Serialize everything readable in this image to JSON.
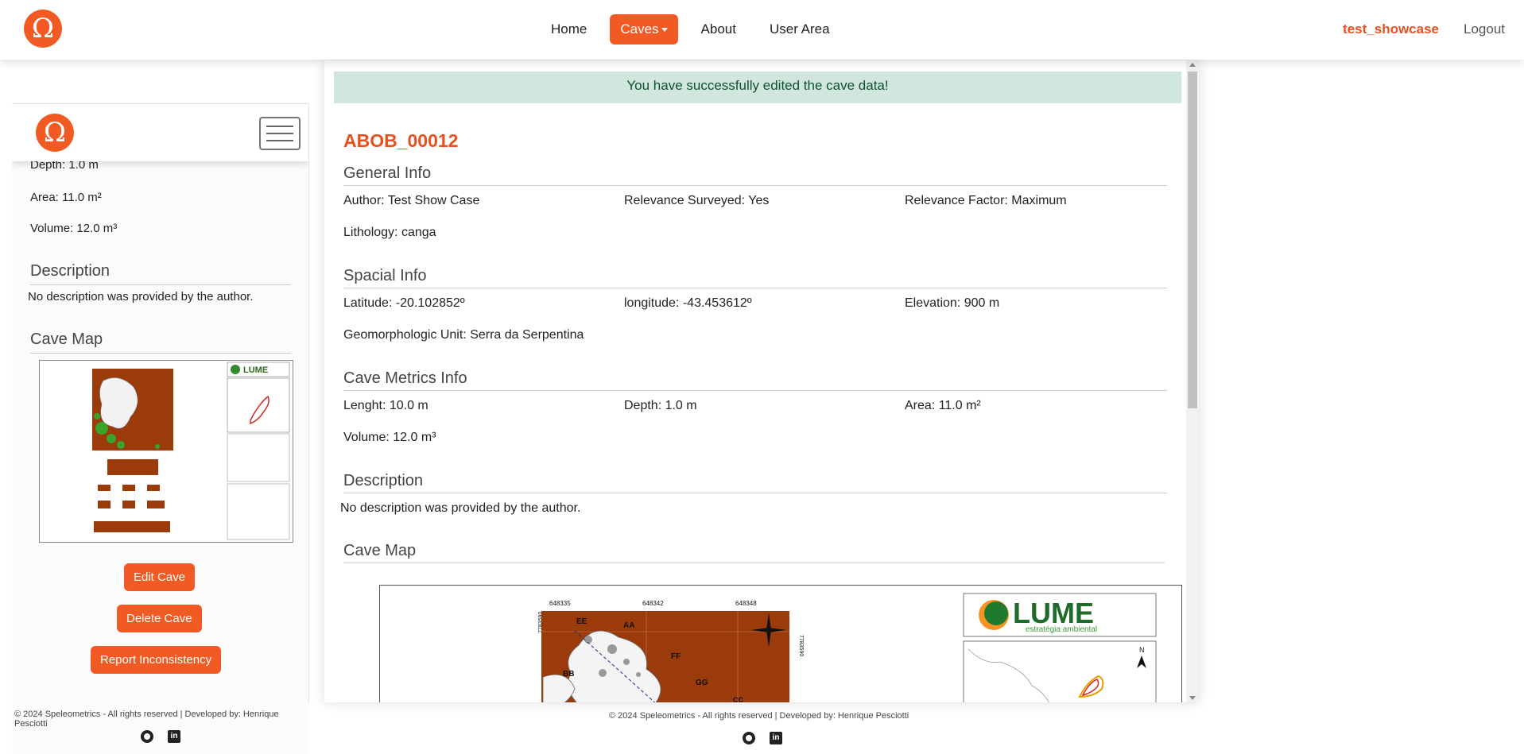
{
  "nav": {
    "items": [
      "Home",
      "Caves",
      "About",
      "User Area"
    ],
    "active": "Caves",
    "username": "test_showcase",
    "logout": "Logout",
    "logo_glyph": "Ω"
  },
  "sidebar": {
    "metrics": [
      "Depth: 1.0 m",
      "Area: 11.0 m²",
      "Volume: 12.0 m³"
    ],
    "description_heading": "Description",
    "description_text": "No description was provided by the author.",
    "map_heading": "Cave Map",
    "buttons": {
      "edit": "Edit Cave",
      "delete": "Delete Cave",
      "report": "Report Inconsistency"
    }
  },
  "main": {
    "alert": "You have successfully edited the cave data!",
    "title": "ABOB_00012",
    "general": {
      "heading": "General Info",
      "author": "Author: Test Show Case",
      "relevance_surveyed": "Relevance Surveyed: Yes",
      "relevance_factor": "Relevance Factor: Maximum",
      "lithology": "Lithology: canga"
    },
    "spacial": {
      "heading": "Spacial Info",
      "latitude": "Latitude: -20.102852º",
      "longitude": "longitude: -43.453612º",
      "elevation": "Elevation: 900 m",
      "geomorph": "Geomorphologic Unit: Serra da Serpentina"
    },
    "metrics": {
      "heading": "Cave Metrics Info",
      "length": "Lenght: 10.0 m",
      "depth": "Depth: 1.0 m",
      "area": "Area: 11.0 m²",
      "volume": "Volume: 12.0 m³"
    },
    "description": {
      "heading": "Description",
      "text": "No description was provided by the author."
    },
    "map": {
      "heading": "Cave Map",
      "brand": "LUME",
      "brand_sub": "estratégia ambiental",
      "north": "N",
      "labels": [
        "648335",
        "648342",
        "648348",
        "EE",
        "AA",
        "FF",
        "BB",
        "GG",
        "CC",
        "7783590",
        "7783590"
      ]
    }
  },
  "footer": {
    "text": "© 2024 Speleometrics - All rights reserved | Developed by: Henrique Pesciotti"
  },
  "colors": {
    "accent": "#f15a22",
    "alert_bg": "#d1e7dd",
    "alert_text": "#0f5132",
    "map_rock": "#9b3a0a"
  },
  "icons": [
    "omega-logo-icon",
    "hamburger-icon",
    "github-icon",
    "linkedin-icon",
    "compass-rose-icon"
  ]
}
